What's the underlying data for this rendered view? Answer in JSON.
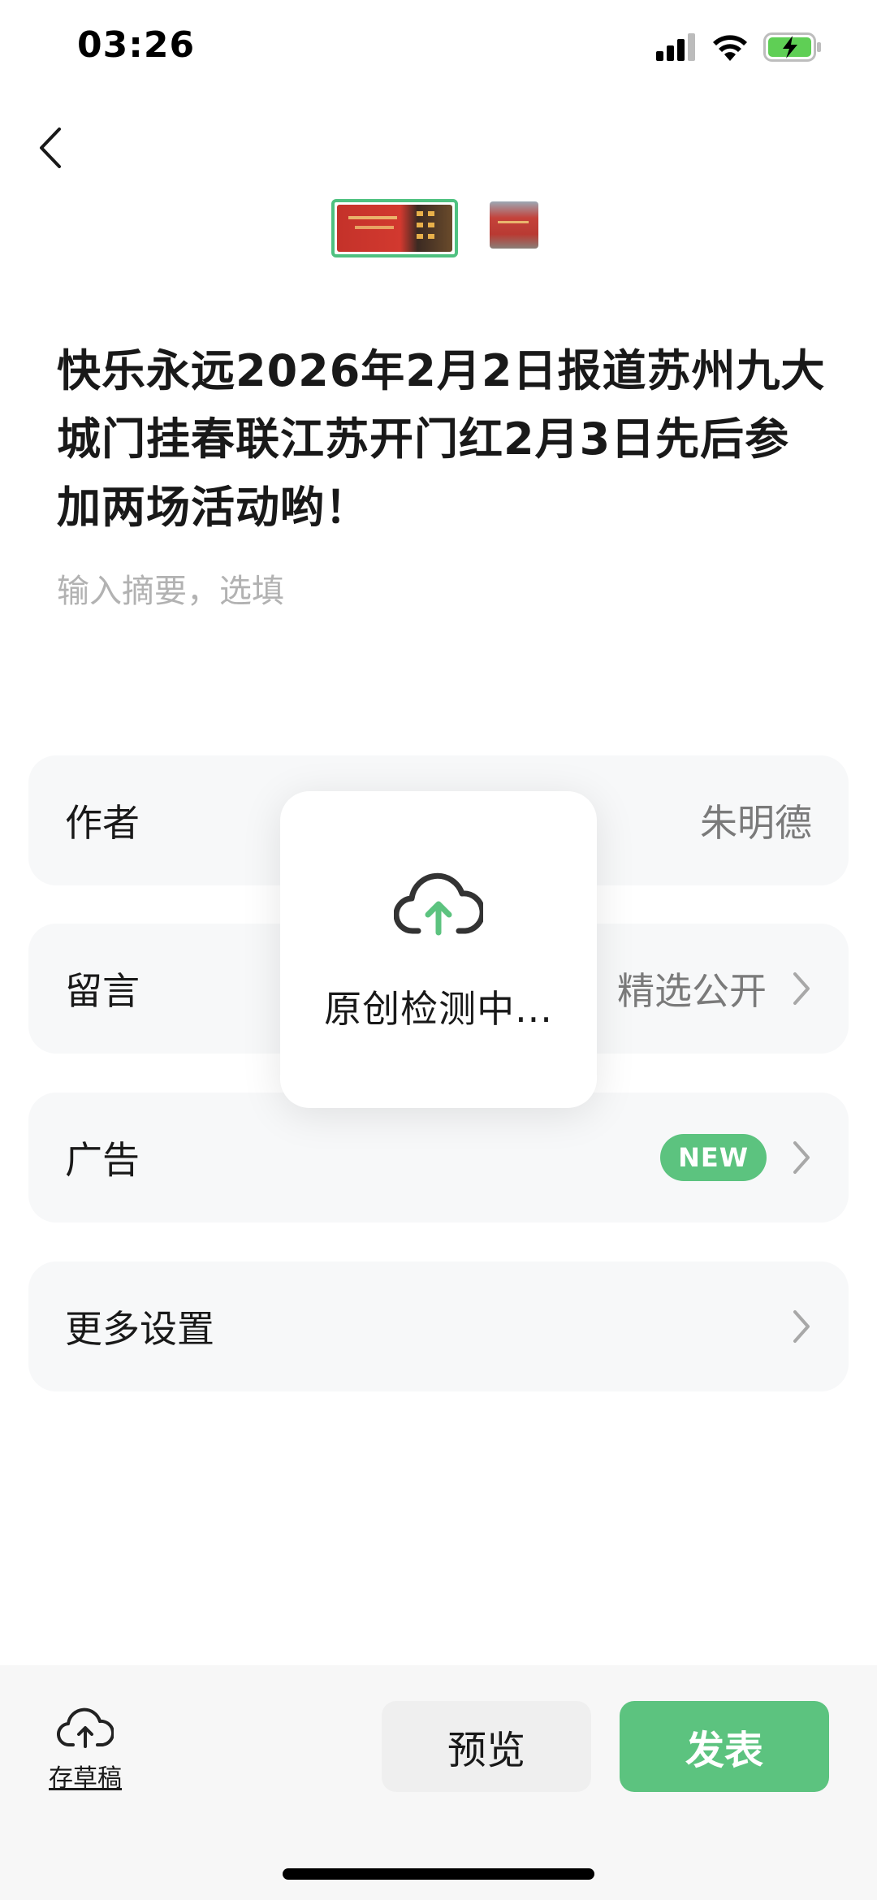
{
  "status_bar": {
    "time": "03:26",
    "icons": [
      "signal-icon",
      "wifi-icon",
      "battery-charging-icon"
    ]
  },
  "nav": {
    "back_icon": "chevron-left-icon"
  },
  "thumbnails": {
    "count": 2,
    "selected_index": 0
  },
  "article": {
    "title": "快乐永远2026年2月2日报道苏州九大城门挂春联江苏开门红2月3日先后参加两场活动哟！",
    "summary_placeholder": "输入摘要，选填"
  },
  "settings": {
    "author": {
      "label": "作者",
      "value": "朱明德"
    },
    "comment": {
      "label": "留言",
      "value": "精选公开"
    },
    "ads": {
      "label": "广告",
      "badge": "NEW"
    },
    "more": {
      "label": "更多设置"
    }
  },
  "toast": {
    "icon": "cloud-upload-icon",
    "text": "原创检测中..."
  },
  "bottom_bar": {
    "draft_label": "存草稿",
    "draft_icon": "cloud-upload-icon",
    "preview_label": "预览",
    "publish_label": "发表"
  },
  "colors": {
    "accent": "#5cc37f",
    "background": "#ffffff",
    "card": "#f7f8f9",
    "placeholder": "#b2b2b2"
  }
}
